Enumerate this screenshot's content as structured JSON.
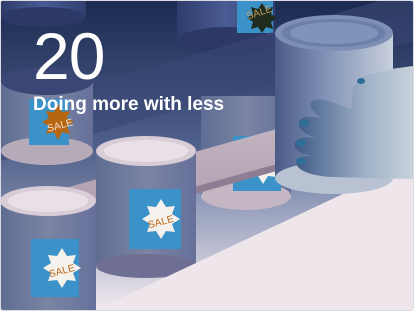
{
  "card": {
    "number": "20",
    "title": "Doing more with less"
  },
  "badges": {
    "sale": "SALE"
  },
  "colors": {
    "background_top": "#1b2a4f",
    "background_mid": "#4b5f8c",
    "background_bottom": "#e6dde4",
    "can_blue": "#3f4f86",
    "label_blue": "#3a92c8",
    "sale_orange": "#b8650f",
    "shelf": "#b7a8b6",
    "skin": "#c9d2dc"
  },
  "icons": [
    "can-icon",
    "sale-badge-icon",
    "hand-icon"
  ]
}
